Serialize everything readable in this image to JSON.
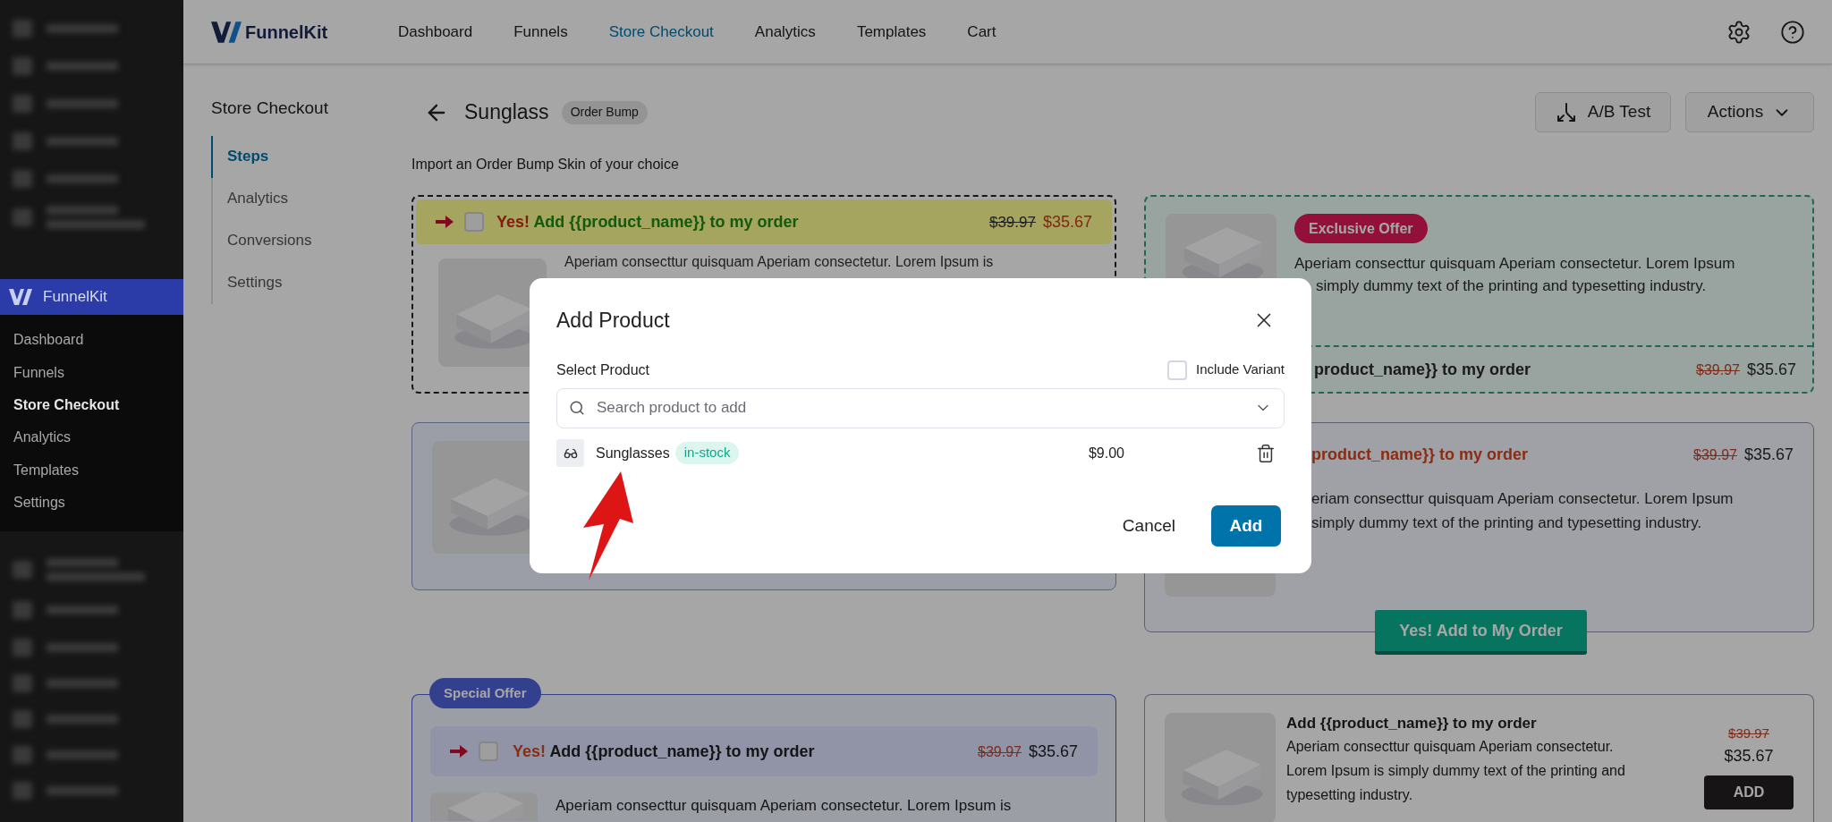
{
  "wp_sidebar": {
    "brand": "FunnelKit",
    "items": [
      {
        "label": "Dashboard",
        "selected": false
      },
      {
        "label": "Funnels",
        "selected": false
      },
      {
        "label": "Store Checkout",
        "selected": true
      },
      {
        "label": "Analytics",
        "selected": false
      },
      {
        "label": "Templates",
        "selected": false
      },
      {
        "label": "Settings",
        "selected": false
      }
    ]
  },
  "top_nav": {
    "logo": "FunnelKit",
    "items": [
      {
        "label": "Dashboard",
        "selected": false
      },
      {
        "label": "Funnels",
        "selected": false
      },
      {
        "label": "Store Checkout",
        "selected": true
      },
      {
        "label": "Analytics",
        "selected": false
      },
      {
        "label": "Templates",
        "selected": false
      },
      {
        "label": "Cart",
        "selected": false
      }
    ]
  },
  "subnav": {
    "title": "Store Checkout",
    "items": [
      {
        "label": "Steps",
        "selected": true
      },
      {
        "label": "Analytics",
        "selected": false
      },
      {
        "label": "Conversions",
        "selected": false
      },
      {
        "label": "Settings",
        "selected": false
      }
    ]
  },
  "header": {
    "title": "Sunglass",
    "badge": "Order Bump",
    "buttons": [
      "A/B Test",
      "Actions"
    ],
    "subtitle": "Import an Order Bump Skin of your choice"
  },
  "skins": [
    {
      "kind": "bar-top",
      "checked": false,
      "yes": "Yes!",
      "title": "Add {{product_name}} to my order",
      "old_price": "$39.97",
      "price": "$35.67",
      "lines": [
        "Aperiam consecttur quisquam Aperiam consectetur. Lorem Ipsum is"
      ]
    },
    {
      "kind": "badge-top",
      "badge": "Exclusive Offer",
      "lines": [
        "Aperiam consecttur quisquam Aperiam consectetur. Lorem Ipsum",
        "simply dummy text of the printing and typesetting industry."
      ],
      "title": "product_name}} to my order",
      "old_price": "$39.97",
      "price": "$35.67"
    },
    {
      "kind": "image-only"
    },
    {
      "kind": "header-button",
      "title": "product_name}} to my order",
      "old_price": "$39.97",
      "price": "$35.67",
      "lines": [
        "eriam consecttur quisquam Aperiam consectetur. Lorem Ipsum",
        "simply dummy text of the printing and typesetting industry."
      ],
      "button": "Yes! Add to My Order"
    },
    {
      "kind": "special-offer",
      "badge": "Special Offer",
      "checked": false,
      "yes": "Yes!",
      "title": "Add {{product_name}} to my order",
      "old_price": "$39.97",
      "price": "$35.67",
      "lines": [
        "Aperiam consecttur quisquam Aperiam consectetur. Lorem Ipsum is"
      ]
    },
    {
      "kind": "side-add",
      "title": "Add {{product_name}} to my order",
      "lines": [
        "Aperiam consecttur quisquam Aperiam consectetur.",
        "Lorem Ipsum is simply dummy text of the printing and",
        "typesetting industry."
      ],
      "old_price": "$39.97",
      "price": "$35.67",
      "button": "ADD"
    }
  ],
  "modal": {
    "title": "Add Product",
    "label": "Select Product",
    "include_variant": {
      "label": "Include Variant",
      "checked": false
    },
    "search": {
      "placeholder": "Search product to add"
    },
    "products": [
      {
        "name": "Sunglasses",
        "badge": "in-stock",
        "price": "$9.00"
      }
    ],
    "buttons": [
      "Cancel",
      "Add"
    ]
  }
}
